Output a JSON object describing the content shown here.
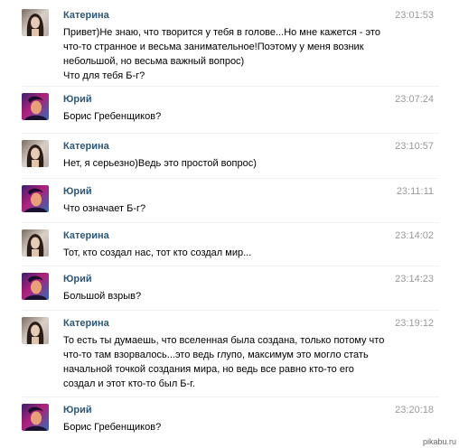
{
  "messages": [
    {
      "author": "Катерина",
      "avatar": "katerina-avatar",
      "time": "23:01:53",
      "lines": [
        "Привет)Не знаю, что творится у тебя в голове...Но мне кажется - это",
        "что-то странное и весьма занимательное!Поэтому у меня возник",
        "небольшой, но весьма важный вопрос)",
        "Что для тебя Б-г?"
      ]
    },
    {
      "author": "Юрий",
      "avatar": "yuri-avatar",
      "time": "23:07:24",
      "lines": [
        "Борис Гребенщиков?"
      ]
    },
    {
      "author": "Катерина",
      "avatar": "katerina-avatar",
      "time": "23:10:57",
      "lines": [
        "Нет, я серьезно)Ведь это простой вопрос)"
      ]
    },
    {
      "author": "Юрий",
      "avatar": "yuri-avatar",
      "time": "23:11:11",
      "lines": [
        "Что означает Б-г?"
      ]
    },
    {
      "author": "Катерина",
      "avatar": "katerina-avatar",
      "time": "23:14:02",
      "lines": [
        "Тот, кто создал нас, тот кто создал мир..."
      ]
    },
    {
      "author": "Юрий",
      "avatar": "yuri-avatar",
      "time": "23:14:23",
      "lines": [
        "Большой взрыв?"
      ]
    },
    {
      "author": "Катерина",
      "avatar": "katerina-avatar",
      "time": "23:19:12",
      "lines": [
        "То есть ты думаешь, что вселенная была создана, только потому что",
        "что-то там взорвалось...это ведь глупо, максимум это могло стать",
        "начальной точкой создания мира, но ведь все равно кто-то его",
        "создал и этот кто-то был Б-г."
      ]
    },
    {
      "author": "Юрий",
      "avatar": "yuri-avatar",
      "time": "23:20:18",
      "lines": [
        "Борис Гребенщиков?"
      ]
    }
  ],
  "watermark": "pikabu.ru"
}
